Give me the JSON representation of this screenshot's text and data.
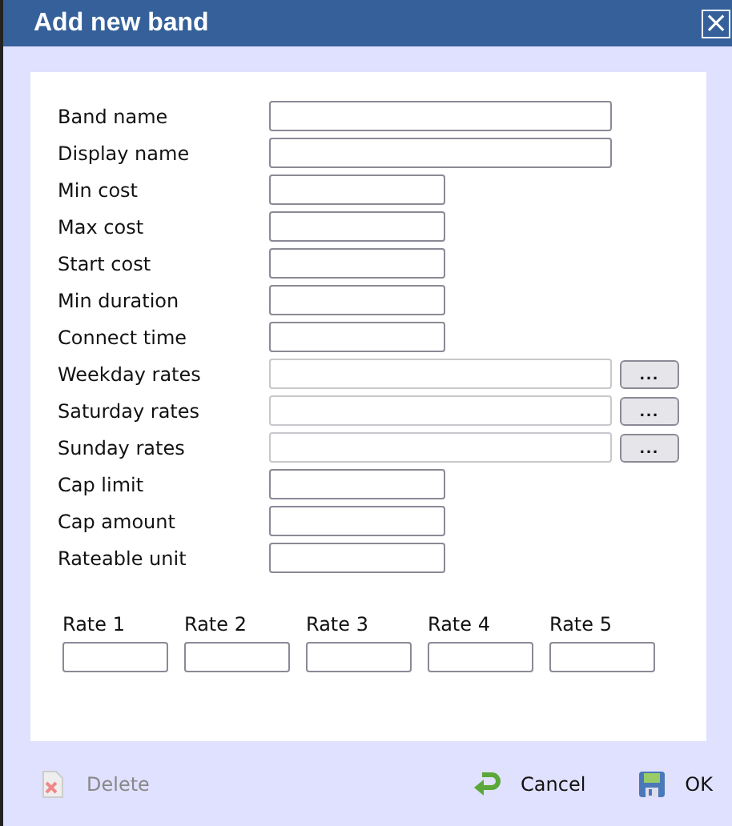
{
  "window": {
    "title": "Add new band",
    "close": "×"
  },
  "fields": [
    {
      "label": "Band name",
      "kind": "wide",
      "disabled": false
    },
    {
      "label": "Display name",
      "kind": "wide",
      "disabled": false
    },
    {
      "label": "Min cost",
      "kind": "narrow",
      "disabled": false
    },
    {
      "label": "Max cost",
      "kind": "narrow",
      "disabled": false
    },
    {
      "label": "Start cost",
      "kind": "narrow",
      "disabled": false
    },
    {
      "label": "Min duration",
      "kind": "narrow",
      "disabled": false
    },
    {
      "label": "Connect time",
      "kind": "narrow",
      "disabled": false
    },
    {
      "label": "Weekday rates",
      "kind": "picker",
      "disabled": true,
      "button": "..."
    },
    {
      "label": "Saturday rates",
      "kind": "picker",
      "disabled": true,
      "button": "..."
    },
    {
      "label": "Sunday rates",
      "kind": "picker",
      "disabled": true,
      "button": "..."
    },
    {
      "label": "Cap limit",
      "kind": "narrow",
      "disabled": false
    },
    {
      "label": "Cap amount",
      "kind": "narrow",
      "disabled": false
    },
    {
      "label": "Rateable unit",
      "kind": "narrow",
      "disabled": false
    }
  ],
  "rates": [
    {
      "label": "Rate 1"
    },
    {
      "label": "Rate 2"
    },
    {
      "label": "Rate 3"
    },
    {
      "label": "Rate 4"
    },
    {
      "label": "Rate 5"
    }
  ],
  "actions": [
    {
      "label": "Delete",
      "kind": "delete",
      "disabled": true
    },
    {
      "label": "Cancel",
      "kind": "cancel",
      "disabled": false
    },
    {
      "label": "OK",
      "kind": "ok",
      "disabled": false
    }
  ]
}
